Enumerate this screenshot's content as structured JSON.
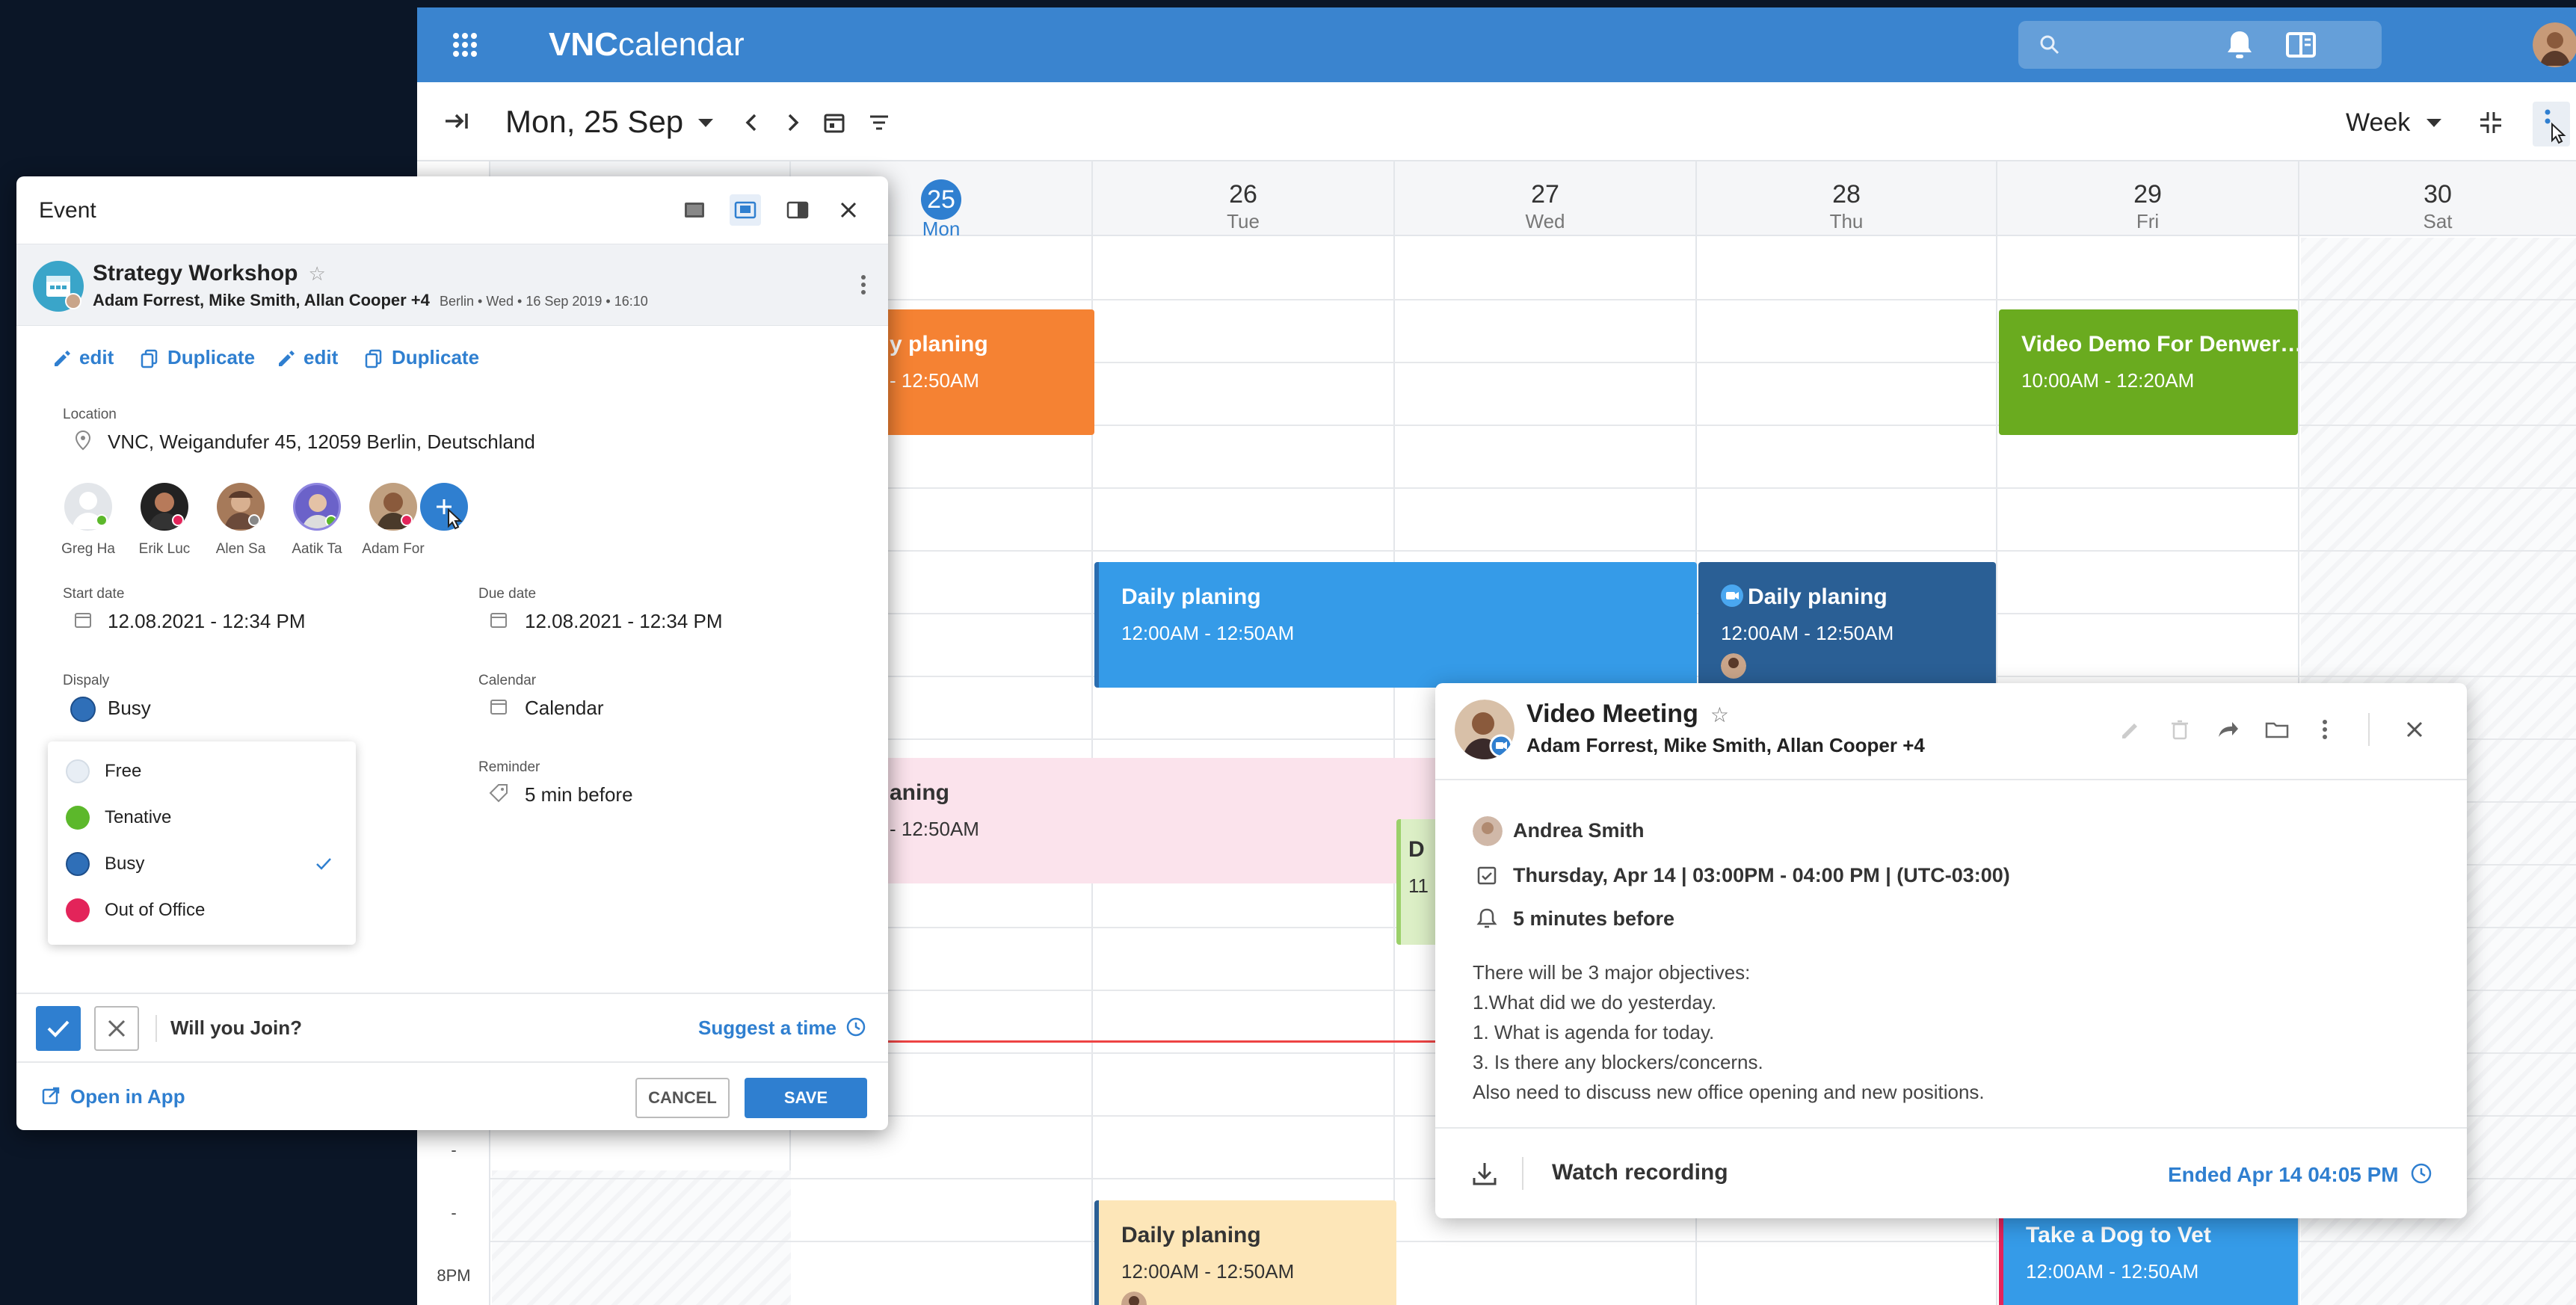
{
  "app": {
    "brand_bold": "VNC",
    "brand_light": "calendar"
  },
  "toolbar": {
    "date_title": "Mon, 25 Sep",
    "view": "Week"
  },
  "days": [
    {
      "num": "25",
      "dow": "Mon",
      "today": true
    },
    {
      "num": "26",
      "dow": "Tue"
    },
    {
      "num": "27",
      "dow": "Wed"
    },
    {
      "num": "28",
      "dow": "Thu"
    },
    {
      "num": "29",
      "dow": "Fri"
    },
    {
      "num": "30",
      "dow": "Sat"
    }
  ],
  "time_labels": [
    "-",
    "-",
    "8PM"
  ],
  "events": {
    "mon_orange_title": "y planing",
    "mon_orange_time": "- 12:50AM",
    "fri_green_title": "Video Demo For Denwer…",
    "fri_green_time": "10:00AM - 12:20AM",
    "tue_wed_blue_title": "Daily planing",
    "tue_wed_blue_time": "12:00AM - 12:50AM",
    "thu_dark_title": "Daily planing",
    "thu_dark_time": "12:00AM - 12:50AM",
    "mon_pink_title": "aning",
    "mon_pink_time": "- 12:50AM",
    "wed_green_title": "D",
    "wed_green_time": "11",
    "tue_yellow_title": "Daily planing",
    "tue_yellow_time": "12:00AM - 12:50AM",
    "fri_blue_title": "Take a Dog to Vet",
    "fri_blue_time": "12:00AM - 12:50AM"
  },
  "dialog": {
    "header_title": "Event",
    "event_title": "Strategy Workshop",
    "event_people": "Adam Forrest, Mike Smith, Allan Cooper +4",
    "event_meta": "Berlin • Wed • 16 Sep 2019 • 16:10",
    "actions": [
      "edit",
      "Duplicate",
      "edit",
      "Duplicate"
    ],
    "location_label": "Location",
    "location_value": "VNC, Weigandufer 45, 12059 Berlin, Deutschland",
    "attendees": [
      "Greg Ha",
      "Erik Luc",
      "Alen Sa",
      "Aatik Ta",
      "Adam For"
    ],
    "start_label": "Start date",
    "start_value": "12.08.2021 - 12:34 PM",
    "due_label": "Due date",
    "due_value": "12.08.2021 - 12:34 PM",
    "display_label": "Dispaly",
    "display_value": "Busy",
    "calendar_label": "Calendar",
    "calendar_value": "Calendar",
    "reminder_label": "Reminder",
    "reminder_value": "5 min before",
    "display_options": [
      {
        "label": "Free",
        "color": "#e8eef5"
      },
      {
        "label": "Tenative",
        "color": "#5cb82b"
      },
      {
        "label": "Busy",
        "color": "#2f6fb8"
      },
      {
        "label": "Out of Office",
        "color": "#e3245a"
      }
    ],
    "join_question": "Will you Join?",
    "suggest_time": "Suggest a time",
    "open_in_app": "Open in App",
    "cancel": "CANCEL",
    "save": "SAVE"
  },
  "video_popup": {
    "title": "Video Meeting",
    "people": "Adam Forrest, Mike Smith, Allan Cooper +4",
    "organizer": "Andrea Smith",
    "datetime": "Thursday, Apr 14  |  03:00PM - 04:00 PM | (UTC-03:00)",
    "reminder": "5 minutes before",
    "description": [
      "There will be 3 major objectives:",
      "1.What did we do yesterday.",
      "1. What is agenda for today.",
      "3. Is there any blockers/concerns.",
      "Also need to discuss new office opening and new positions."
    ],
    "watch_recording": "Watch recording",
    "ended": "Ended Apr 14 04:05 PM"
  },
  "colors": {
    "header": "#3a84cf",
    "accent": "#2f7fd0",
    "orange": "#f58233",
    "green": "#6aab1f",
    "blue_event": "#359be8",
    "dark_event": "#2a5f95",
    "pink_event": "#fbe3ec",
    "yellow_event": "#fde6b8"
  }
}
